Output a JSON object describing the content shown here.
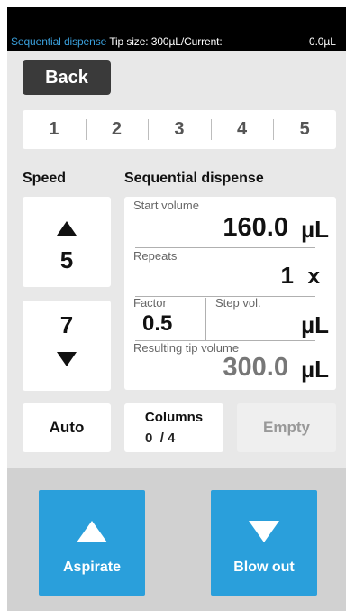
{
  "status_bar": {
    "mode": "Sequential dispense",
    "tip_info": "Tip size:  300µL/Current:",
    "current_value": "0.0µL"
  },
  "header": {
    "back_label": "Back"
  },
  "tabs": [
    {
      "label": "1"
    },
    {
      "label": "2"
    },
    {
      "label": "3"
    },
    {
      "label": "4"
    },
    {
      "label": "5"
    }
  ],
  "speed": {
    "title": "Speed",
    "aspirate_speed": "5",
    "dispense_speed": "7"
  },
  "sequential": {
    "title": "Sequential dispense",
    "start_volume": {
      "label": "Start volume",
      "value": "160.0",
      "unit": "µL"
    },
    "repeats": {
      "label": "Repeats",
      "value": "1",
      "unit": "x"
    },
    "factor": {
      "label": "Factor",
      "value": "0.5"
    },
    "step_vol": {
      "label": "Step vol.",
      "value": "",
      "unit": "µL"
    },
    "resulting": {
      "label": "Resulting tip volume",
      "value": "300.0",
      "unit": "µL"
    }
  },
  "controls": {
    "auto_label": "Auto",
    "columns_label": "Columns",
    "columns_current": "0",
    "columns_total": "/ 4",
    "empty_label": "Empty"
  },
  "actions": {
    "aspirate_label": "Aspirate",
    "blowout_label": "Blow out"
  },
  "colors": {
    "accent_blue": "#2a9fdb",
    "status_mode_blue": "#3aa0dc",
    "main_bg": "#e8e8e8",
    "bottom_bg": "#d1d1d1",
    "back_button": "#3a3a3a"
  }
}
